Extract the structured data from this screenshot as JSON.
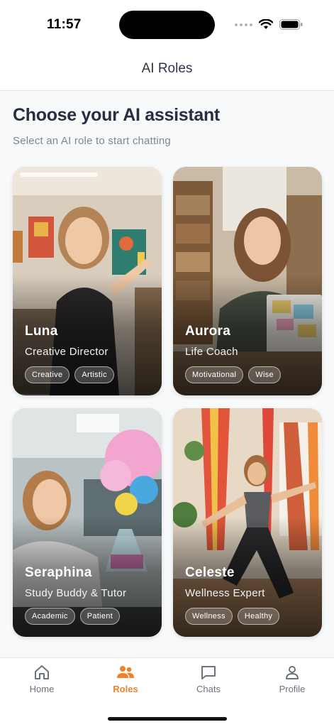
{
  "status_bar": {
    "time": "11:57"
  },
  "header": {
    "title": "AI Roles"
  },
  "main": {
    "title": "Choose your AI assistant",
    "subtitle": "Select an AI role to start chatting"
  },
  "roles": [
    {
      "name": "Luna",
      "role": "Creative Director",
      "tags": [
        "Creative",
        "Artistic"
      ]
    },
    {
      "name": "Aurora",
      "role": "Life Coach",
      "tags": [
        "Motivational",
        "Wise"
      ]
    },
    {
      "name": "Seraphina",
      "role": "Study Buddy & Tutor",
      "tags": [
        "Academic",
        "Patient"
      ]
    },
    {
      "name": "Celeste",
      "role": "Wellness Expert",
      "tags": [
        "Wellness",
        "Healthy"
      ]
    }
  ],
  "tab_bar": {
    "items": [
      {
        "label": "Home",
        "icon": "home-icon",
        "active": false
      },
      {
        "label": "Roles",
        "icon": "users-icon",
        "active": true
      },
      {
        "label": "Chats",
        "icon": "chat-icon",
        "active": false
      },
      {
        "label": "Profile",
        "icon": "profile-icon",
        "active": false
      }
    ]
  },
  "colors": {
    "accent": "#f0822a",
    "title": "#252f3f",
    "muted": "#7b8794",
    "background": "#f8f9fa"
  }
}
